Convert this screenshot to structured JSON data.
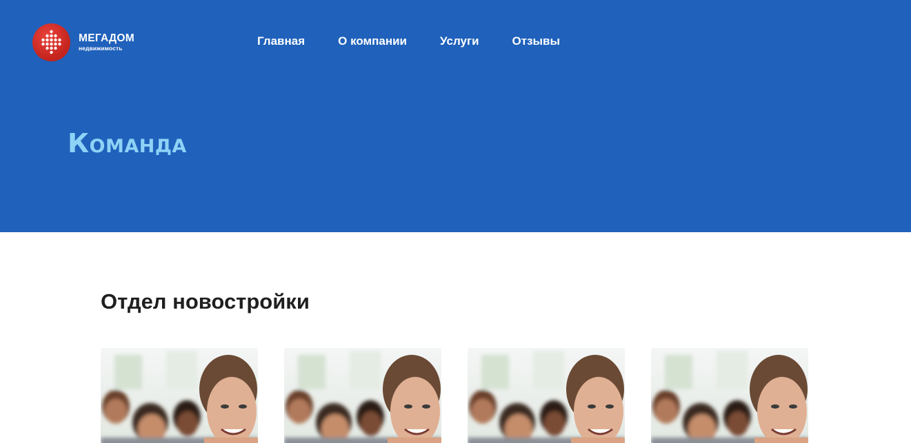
{
  "header": {
    "logo": {
      "name": "МЕГАДОМ",
      "subtitle": "недвижимость",
      "mark_color": "#d0261f"
    },
    "nav": [
      {
        "label": "Главная"
      },
      {
        "label": "О компании"
      },
      {
        "label": "Услуги"
      },
      {
        "label": "Отзывы"
      }
    ],
    "background_color": "#1f61bb"
  },
  "hero": {
    "title": "Команда",
    "title_color": "#8ed2f6"
  },
  "section": {
    "title": "Отдел новостройки",
    "cards": [
      {
        "photo": "team-photo"
      },
      {
        "photo": "team-photo"
      },
      {
        "photo": "team-photo"
      },
      {
        "photo": "team-photo"
      }
    ]
  }
}
